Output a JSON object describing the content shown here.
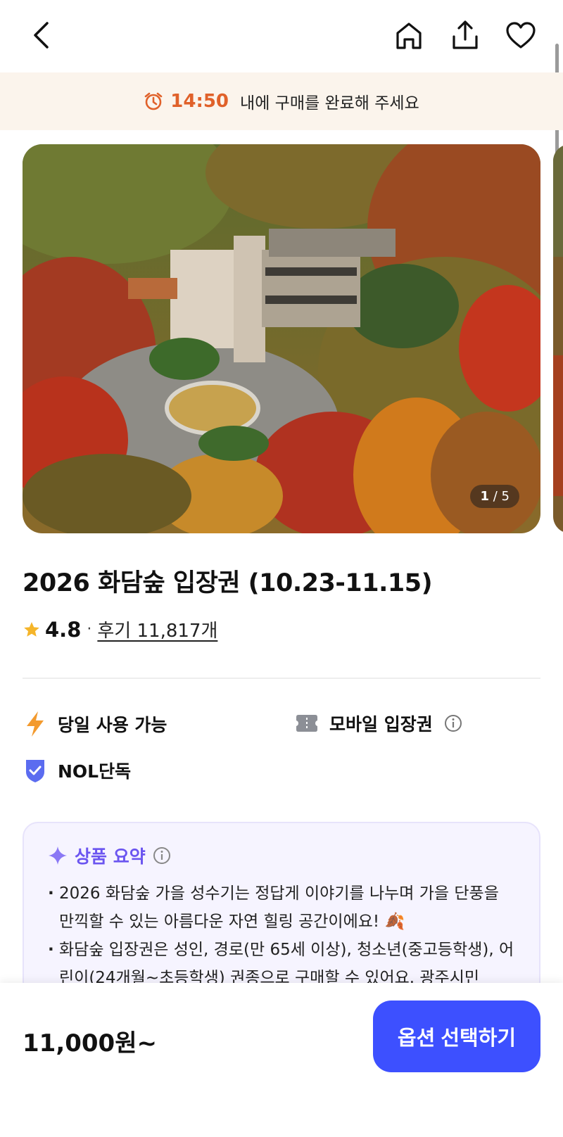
{
  "header": {
    "icons": [
      "back-arrow-icon",
      "home-icon",
      "share-icon",
      "heart-icon"
    ]
  },
  "timer": {
    "icon": "alarm-clock-icon",
    "time": "14:50",
    "message": "내에 구매를 완료해 주세요"
  },
  "gallery": {
    "current": "1",
    "total": "/ 5"
  },
  "product": {
    "title": "2026 화담숲 입장권 (10.23-11.15)",
    "rating": "4.8",
    "separator": "·",
    "reviews": "후기 11,817개"
  },
  "features": [
    {
      "icon": "lightning-icon",
      "label": "당일 사용 가능"
    },
    {
      "icon": "ticket-icon",
      "label": "모바일 입장권",
      "info_icon": "info-icon"
    },
    {
      "icon": "shield-check-icon",
      "label": "NOL단독"
    }
  ],
  "summary": {
    "icon": "sparkle-icon",
    "title": "상품 요약",
    "info_icon": "info-icon",
    "items": [
      "2026 화담숲 가을 성수기는 정답게 이야기를 나누며 가을 단풍을 만끽할 수 있는 아름다운 자연 힐링 공간이에요! 🍂",
      "화담숲 입장권은 성인, 경로(만 65세 이상), 청소년(중고등학생), 어린이(24개월~초등학생) 권종으로 구매할 수 있어요. 광주시민"
    ]
  },
  "bottom": {
    "price": "11,000원~",
    "cta": "옵션 선택하기"
  },
  "colors": {
    "accent": "#3d50ff",
    "timer": "#e0612a",
    "summary_title": "#6b55f0",
    "star": "#f5b52a"
  }
}
